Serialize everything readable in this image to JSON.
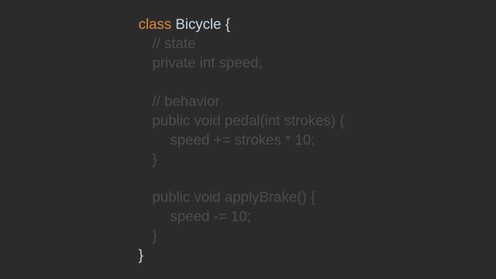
{
  "code": {
    "open": {
      "keyword": "class",
      "name": "Bicycle",
      "brace": "{"
    },
    "body": [
      "// state",
      "private int speed;",
      "// behavior",
      "public void pedal(int strokes) {",
      "speed += strokes * 10;",
      "}",
      "public void applyBrake() {",
      "speed -= 10;",
      "}"
    ],
    "close": "}"
  },
  "colors": {
    "background": "#2b2b2b",
    "keyword": "#de8a3a",
    "class_name": "#c6d8ea",
    "dimmed_text": "#4d4d4d"
  }
}
